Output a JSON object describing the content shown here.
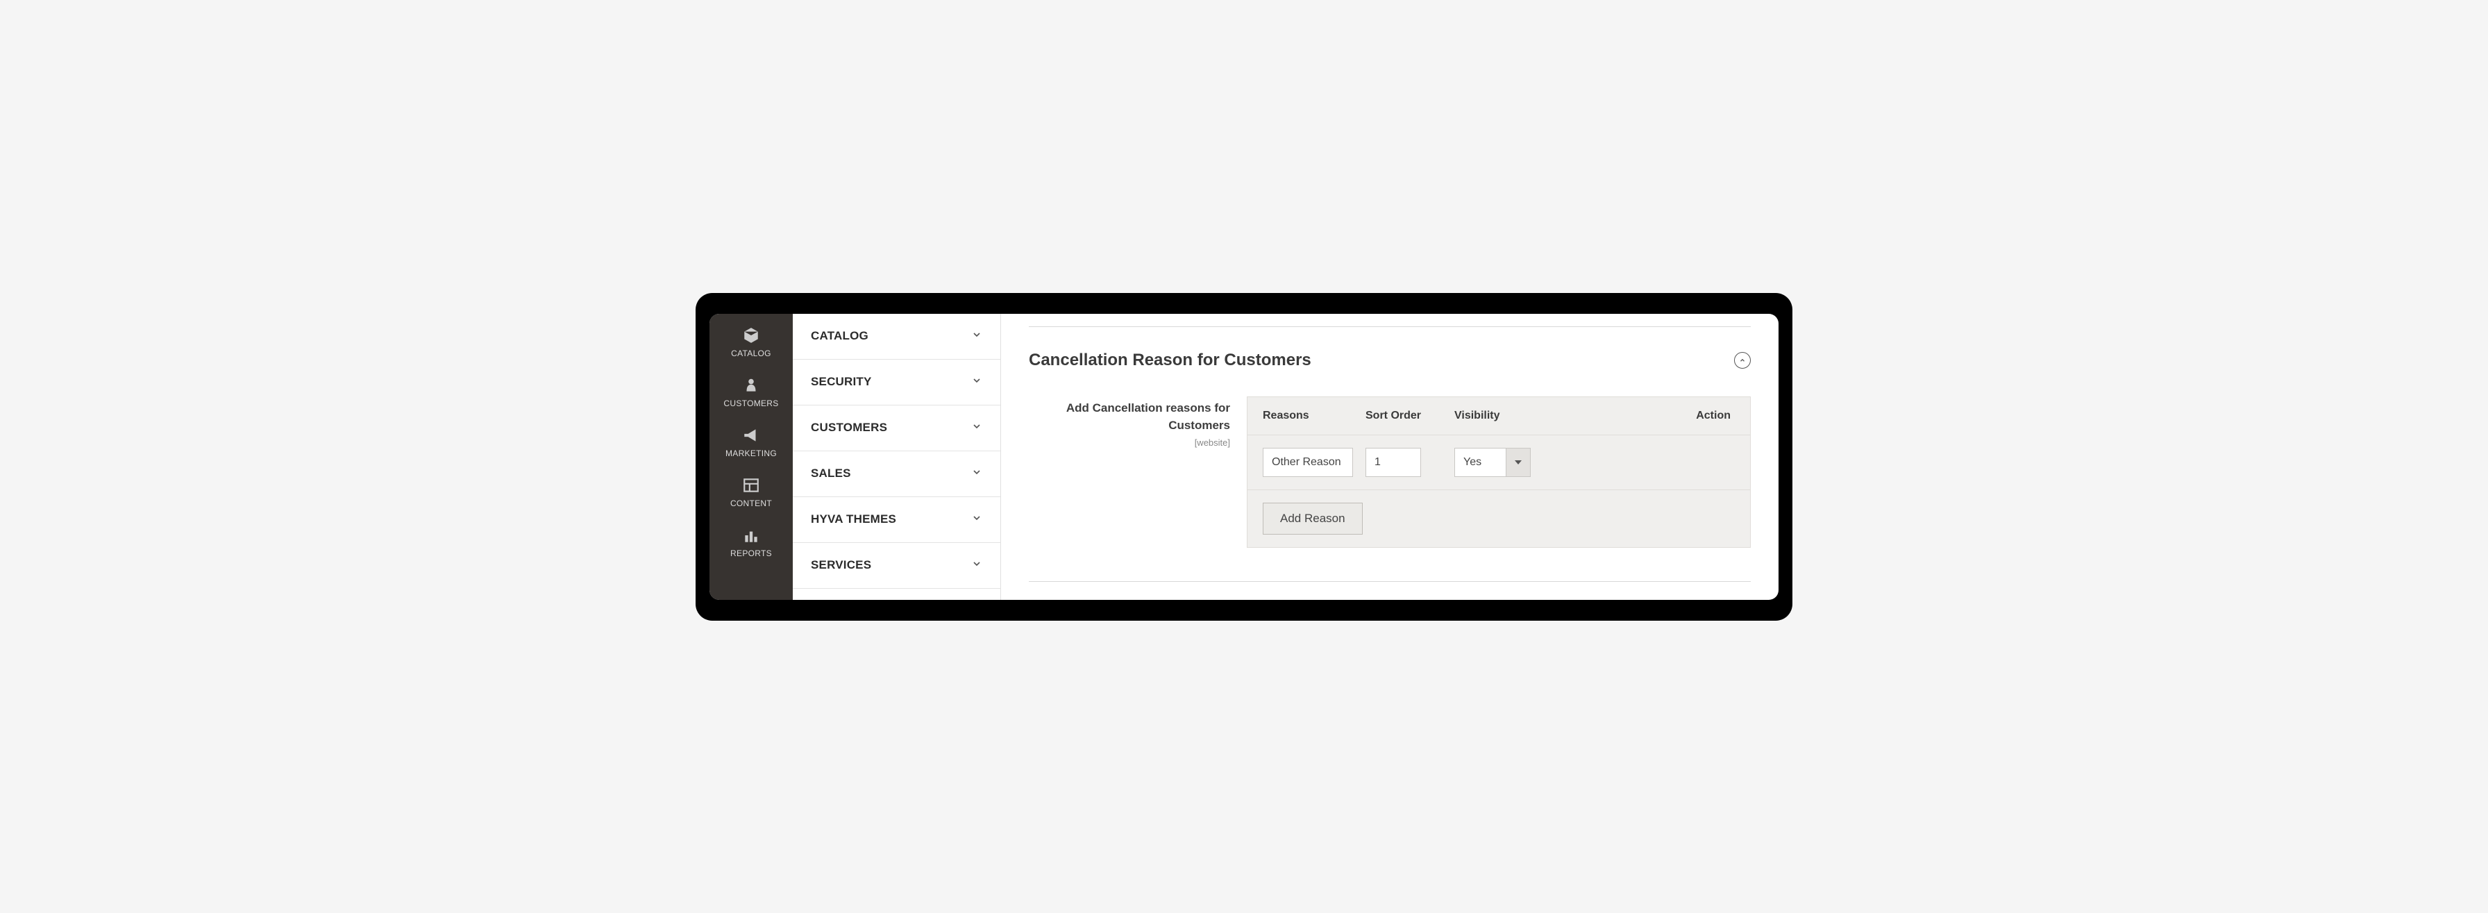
{
  "sidebar_dark": {
    "items": [
      {
        "label": "CATALOG",
        "icon": "box"
      },
      {
        "label": "CUSTOMERS",
        "icon": "person"
      },
      {
        "label": "MARKETING",
        "icon": "megaphone"
      },
      {
        "label": "CONTENT",
        "icon": "layout"
      },
      {
        "label": "REPORTS",
        "icon": "chart"
      }
    ]
  },
  "config_nav": {
    "items": [
      {
        "label": "CATALOG"
      },
      {
        "label": "SECURITY"
      },
      {
        "label": "CUSTOMERS"
      },
      {
        "label": "SALES"
      },
      {
        "label": "HYVA THEMES"
      },
      {
        "label": "SERVICES"
      }
    ]
  },
  "section": {
    "title": "Cancellation Reason for Customers"
  },
  "form": {
    "label": "Add Cancellation reasons for Customers",
    "scope": "[website]"
  },
  "table": {
    "headers": {
      "reasons": "Reasons",
      "sort_order": "Sort Order",
      "visibility": "Visibility",
      "action": "Action"
    },
    "rows": [
      {
        "reason_value": "Other Reason",
        "sort_order_value": "1",
        "visibility_value": "Yes"
      }
    ],
    "add_button": "Add Reason"
  }
}
